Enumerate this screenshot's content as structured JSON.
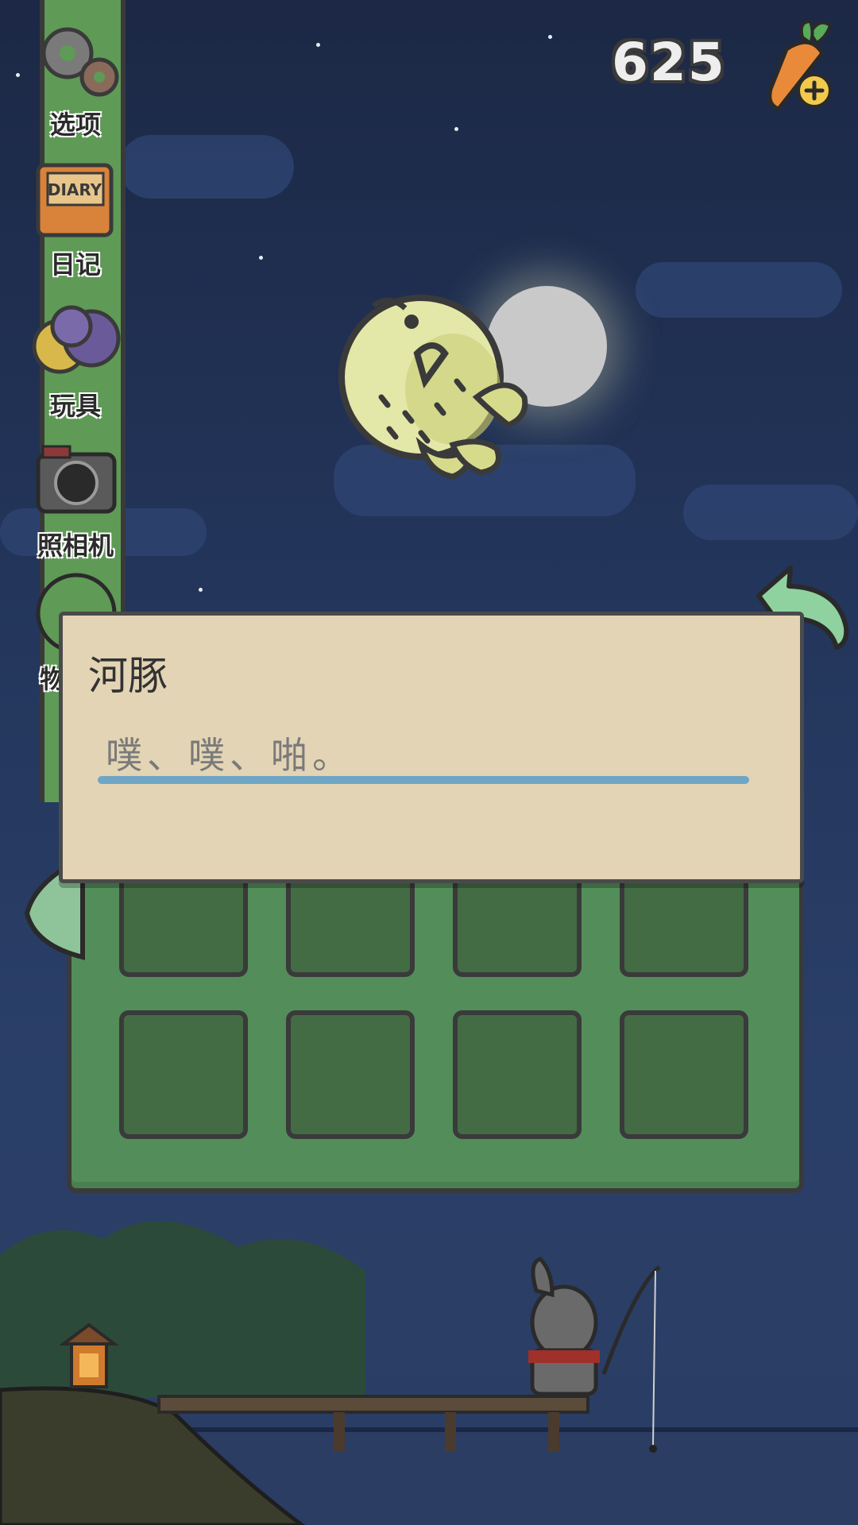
{
  "currency": {
    "carrots": "625",
    "add_icon": "carrot-plus-icon"
  },
  "menu": {
    "items": [
      {
        "label": "选项",
        "icon": "gear-icon"
      },
      {
        "label": "日记",
        "icon": "diary-icon"
      },
      {
        "label": "玩具",
        "icon": "toy-balls-icon"
      },
      {
        "label": "照相机",
        "icon": "camera-icon"
      },
      {
        "label": "物",
        "icon": "bag-icon"
      }
    ]
  },
  "dialog": {
    "speaker": "河豚",
    "text": "噗、噗、啪。"
  },
  "inventory": {
    "slots_visible": 8
  },
  "colors": {
    "panel_green": "#538d5a",
    "slot_green": "#436c45",
    "dialog_bg": "#e3d4b5",
    "progress_bar": "#6fa6c5",
    "sky": "#223459"
  },
  "diary_cover_text": "DIARY"
}
